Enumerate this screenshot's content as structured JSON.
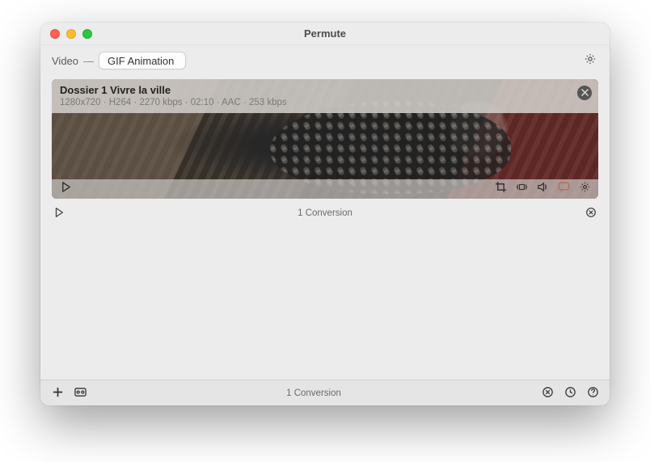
{
  "window": {
    "title": "Permute"
  },
  "toolbar": {
    "type_label": "Video",
    "dash": "—",
    "format_selected": "GIF Animation"
  },
  "item": {
    "title": "Dossier 1 Vivre la ville",
    "meta_parts": {
      "resolution": "1280x720",
      "video_codec": "H264",
      "video_bitrate": "2270 kbps",
      "duration": "02:10",
      "audio_codec": "AAC",
      "audio_bitrate": "253 kbps"
    },
    "meta_line": "1280x720 · H264 · 2270 kbps · 02:10 · AAC · 253 kbps"
  },
  "status": {
    "count_text": "1 Conversion"
  },
  "footer": {
    "count_text": "1 Conversion"
  }
}
